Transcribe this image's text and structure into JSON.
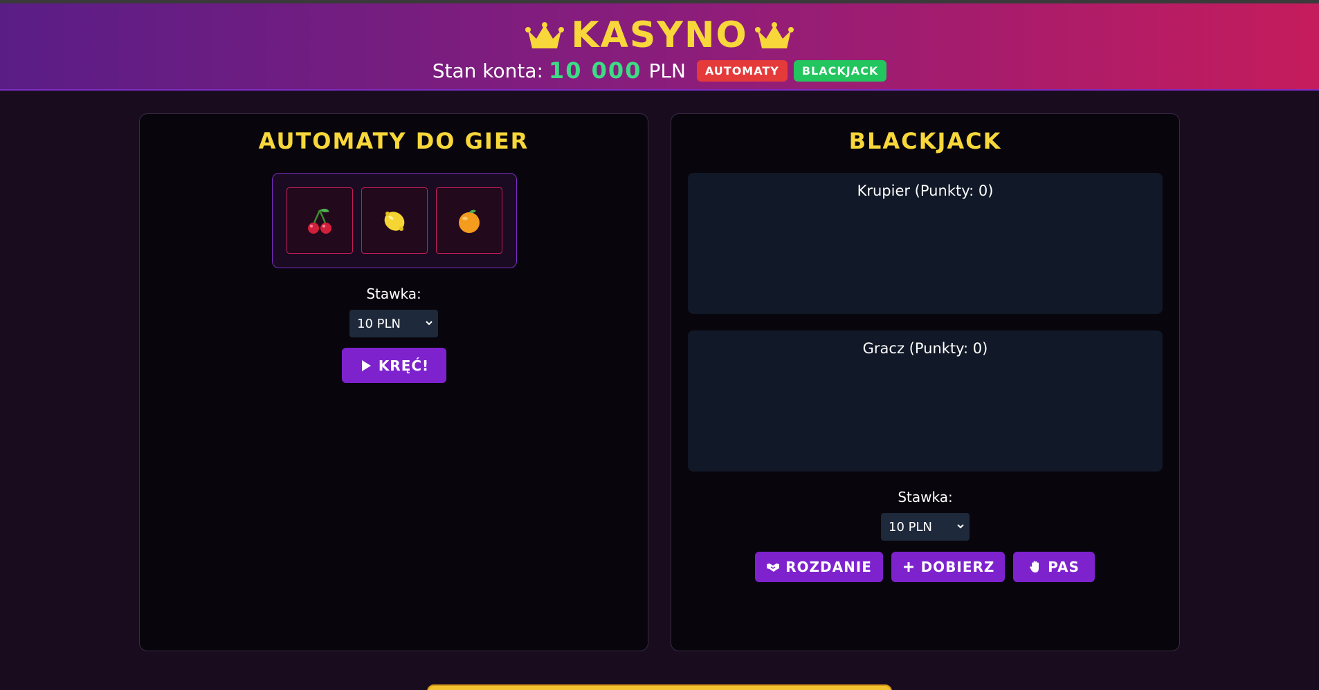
{
  "header": {
    "title": "KASYNO",
    "balance_label": "Stan konta:",
    "balance_value": "10 000",
    "balance_currency": "PLN",
    "badges": [
      {
        "label": "AUTOMATY",
        "color": "#e53a3a"
      },
      {
        "label": "BLACKJACK",
        "color": "#22c55e"
      }
    ],
    "crown_icon": "crown-icon"
  },
  "slots": {
    "title": "AUTOMATY DO GIER",
    "reels": [
      {
        "symbol": "cherry-icon"
      },
      {
        "symbol": "lemon-icon"
      },
      {
        "symbol": "orange-icon"
      }
    ],
    "stake_label": "Stawka:",
    "stake_value": "10 PLN",
    "spin_label": "KRĘĆ!"
  },
  "blackjack": {
    "title": "BLACKJACK",
    "dealer_label": "Krupier (Punkty: 0)",
    "player_label": "Gracz (Punkty: 0)",
    "stake_label": "Stawka:",
    "stake_value": "10 PLN",
    "buttons": {
      "deal": "ROZDANIE",
      "hit": "DOBIERZ",
      "stand": "PAS"
    }
  },
  "colors": {
    "accent": "#7e22ce",
    "gold": "#f8d73a",
    "balance": "#3ddc84"
  }
}
